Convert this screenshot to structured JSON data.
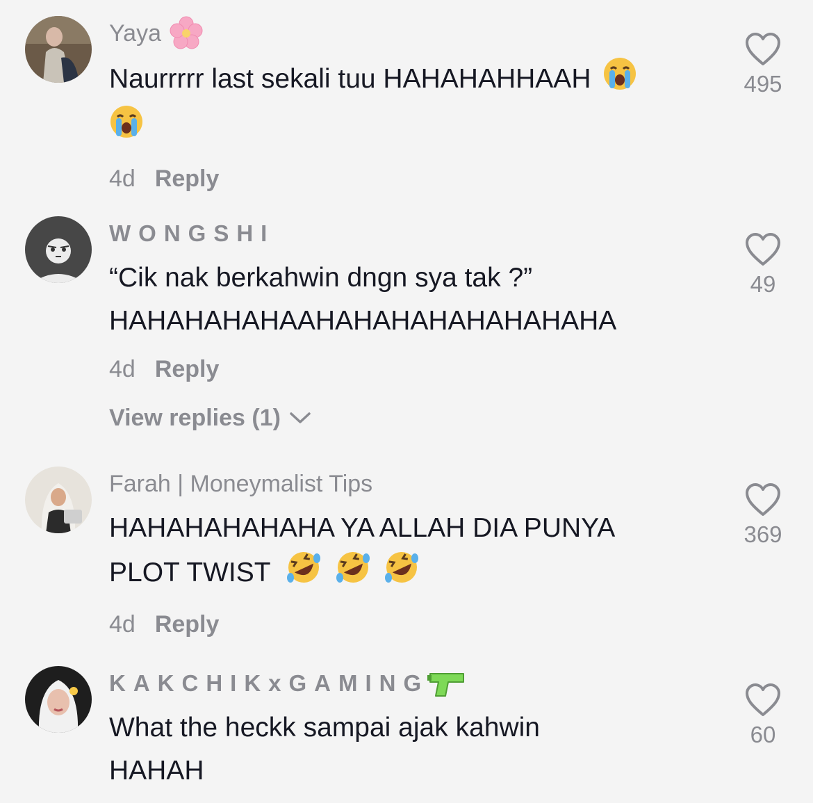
{
  "comments": [
    {
      "username": "Yaya",
      "username_emoji": "cherry-blossom",
      "text_line1": "Naurrrrr last sekali tuu HAHAHAHHAAH",
      "text_line2": "",
      "text_emojis": [
        "loudly-crying-face",
        "loudly-crying-face"
      ],
      "time": "4d",
      "reply_label": "Reply",
      "likes": "495"
    },
    {
      "username": "WONGSHI",
      "username_emoji": "",
      "text_line1": "“Cik nak berkahwin dngn sya tak ?”",
      "text_line2": "HAHAHAHAHAAHAHAHAHAHAHAHAHA",
      "time": "4d",
      "reply_label": "Reply",
      "view_replies": "View replies (1)",
      "likes": "49"
    },
    {
      "username": "Farah | Moneymalist Tips",
      "username_emoji": "",
      "text_line1": "HAHAHAHAHAHA YA ALLAH DIA PUNYA",
      "text_line2": "PLOT TWIST",
      "text_emojis": [
        "rolling-on-floor-laughing",
        "rolling-on-floor-laughing",
        "rolling-on-floor-laughing"
      ],
      "time": "4d",
      "reply_label": "Reply",
      "likes": "369"
    },
    {
      "username": "KAKCHIKxGAMING",
      "username_emoji": "water-pistol",
      "text_line1": "What the heckk sampai ajak kahwin",
      "text_line2": "HAHAH",
      "likes": "60"
    }
  ],
  "colors": {
    "background": "#f4f4f4",
    "primary_text": "#161823",
    "secondary_text": "#8a8b91"
  }
}
